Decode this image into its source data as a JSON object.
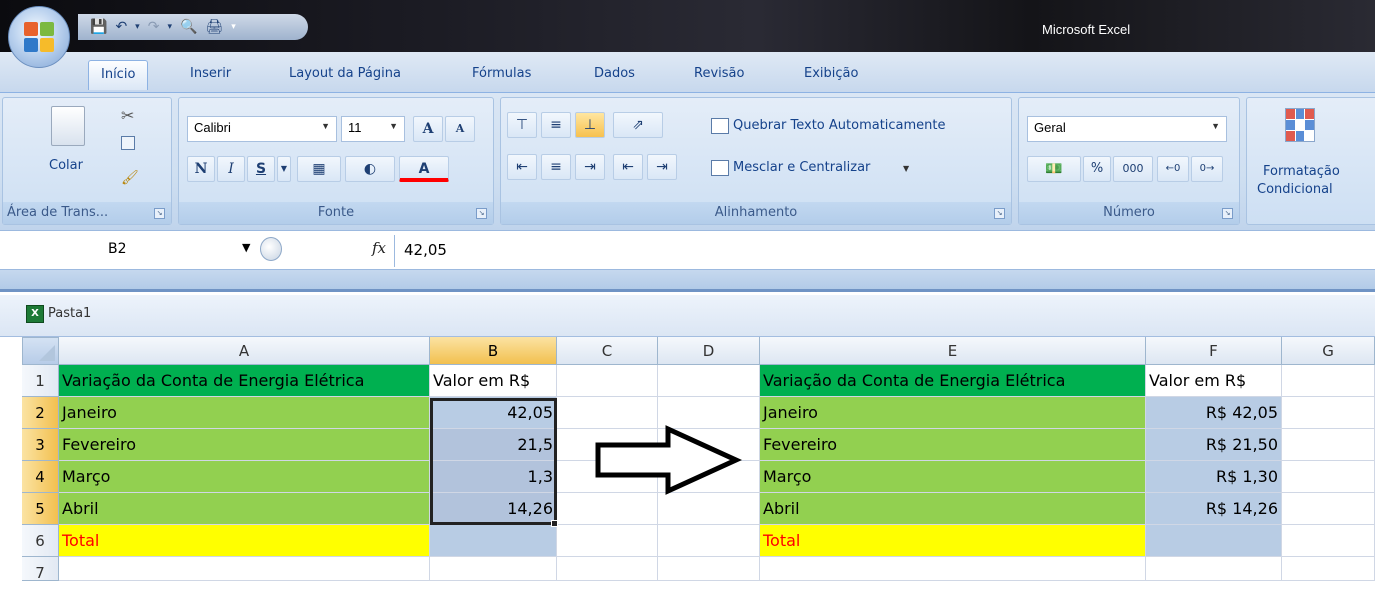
{
  "window": {
    "title": "Microsoft Excel"
  },
  "colors": {
    "header_green": "#00b050",
    "row_green": "#92d050",
    "total_yellow": "#ffff00",
    "value_blue": "#b8cce4",
    "total_red": "#ff0000"
  },
  "tabs": [
    "Início",
    "Inserir",
    "Layout da Página",
    "Fórmulas",
    "Dados",
    "Revisão",
    "Exibição"
  ],
  "ribbon": {
    "clipboard": {
      "paste_label": "Colar",
      "group_label": "Área de Trans..."
    },
    "font": {
      "font_name": "Calibri",
      "font_size": "11",
      "bold": "N",
      "italic": "I",
      "underline": "S",
      "grow": "A",
      "shrink": "A",
      "color_letter": "A",
      "group_label": "Fonte"
    },
    "alignment": {
      "wrap_text": "Quebrar Texto Automaticamente",
      "merge_center": "Mesclar e Centralizar",
      "group_label": "Alinhamento"
    },
    "number": {
      "format": "Geral",
      "percent": "%",
      "thousands": "000",
      "group_label": "Número"
    },
    "styles": {
      "conditional_line1": "Formatação",
      "conditional_line2": "Condicional"
    }
  },
  "formula_bar": {
    "name_box": "B2",
    "fx": "fx",
    "value": "42,05"
  },
  "workbook": {
    "name": "Pasta1"
  },
  "columns": [
    "A",
    "B",
    "C",
    "D",
    "E",
    "F",
    "G"
  ],
  "rows": [
    "1",
    "2",
    "3",
    "4",
    "5",
    "6",
    "7"
  ],
  "left_table": {
    "header": {
      "label": "Variação da Conta de Energia Elétrica",
      "value": "Valor em R$"
    },
    "items": [
      {
        "label": "Janeiro",
        "value": "42,05"
      },
      {
        "label": "Fevereiro",
        "value": "21,5"
      },
      {
        "label": "Março",
        "value": "1,3"
      },
      {
        "label": "Abril",
        "value": "14,26"
      }
    ],
    "total": "Total"
  },
  "right_table": {
    "header": {
      "label": "Variação da Conta de Energia Elétrica",
      "value": "Valor em R$"
    },
    "items": [
      {
        "label": "Janeiro",
        "value": "R$ 42,05"
      },
      {
        "label": "Fevereiro",
        "value": "R$ 21,50"
      },
      {
        "label": "Março",
        "value": "R$ 1,30"
      },
      {
        "label": "Abril",
        "value": "R$ 14,26"
      }
    ],
    "total": "Total"
  }
}
